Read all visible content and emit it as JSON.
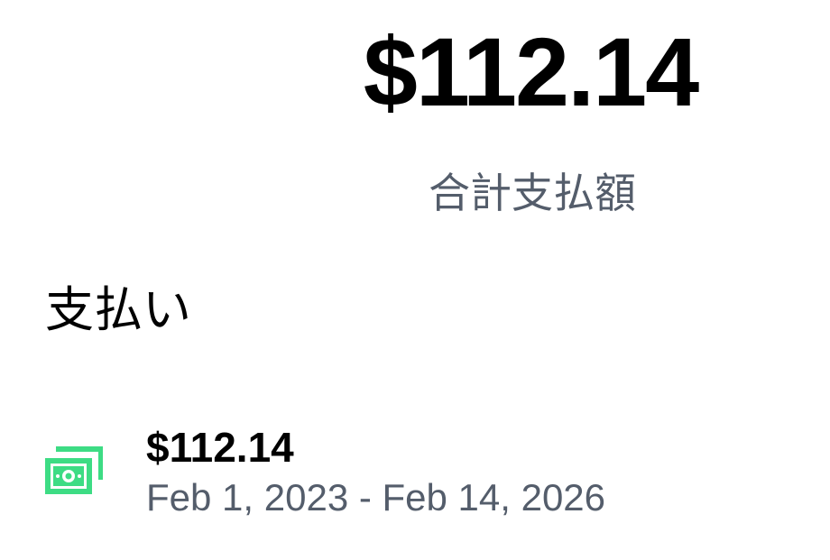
{
  "summary": {
    "total_amount": "$112.14",
    "total_label": "合計支払額"
  },
  "payments_section": {
    "title": "支払い",
    "items": [
      {
        "icon": "cash-icon",
        "icon_color": "#3ddc84",
        "amount": "$112.14",
        "date_range": "Feb 1, 2023 - Feb 14, 2026"
      }
    ]
  }
}
